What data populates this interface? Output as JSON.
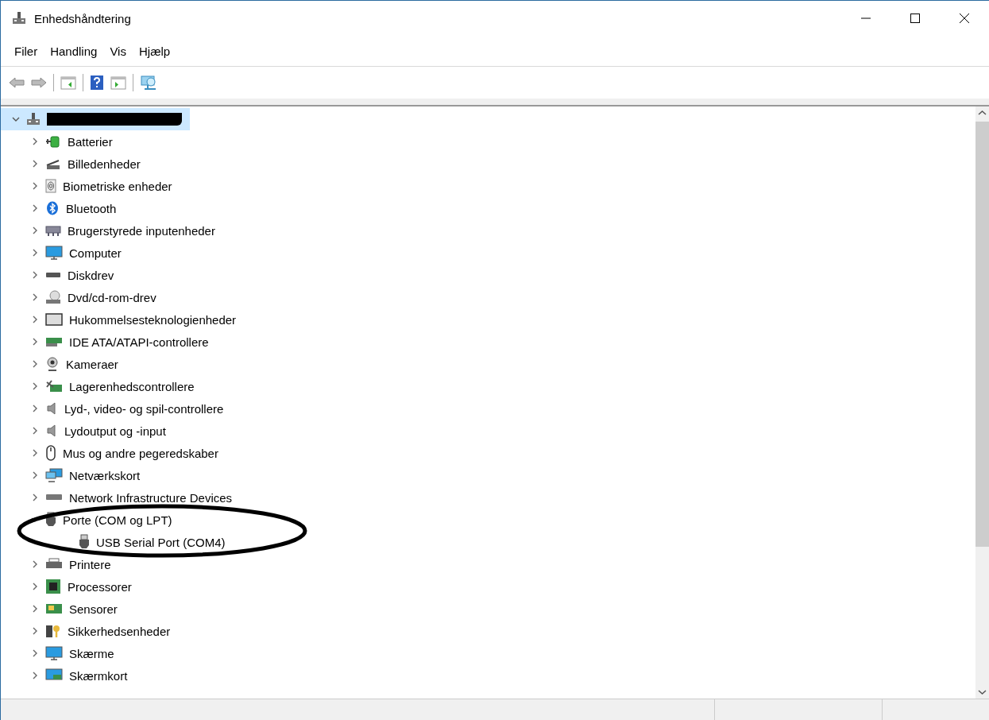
{
  "window": {
    "title": "Enhedshåndtering"
  },
  "menu": [
    "Filer",
    "Handling",
    "Vis",
    "Hjælp"
  ],
  "tree": {
    "expanded": true,
    "selected": true,
    "redacted": true,
    "children": [
      {
        "label": "Batterier",
        "expanded": false,
        "selected": false
      },
      {
        "label": "Billedenheder",
        "expanded": false,
        "selected": false
      },
      {
        "label": "Biometriske enheder",
        "expanded": false,
        "selected": false
      },
      {
        "label": "Bluetooth",
        "expanded": false,
        "selected": false
      },
      {
        "label": "Brugerstyrede inputenheder",
        "expanded": false,
        "selected": false
      },
      {
        "label": "Computer",
        "expanded": false,
        "selected": false
      },
      {
        "label": "Diskdrev",
        "expanded": false,
        "selected": false
      },
      {
        "label": "Dvd/cd-rom-drev",
        "expanded": false,
        "selected": false
      },
      {
        "label": "Hukommelsesteknologienheder",
        "expanded": false,
        "selected": false
      },
      {
        "label": "IDE ATA/ATAPI-controllere",
        "expanded": false,
        "selected": false
      },
      {
        "label": "Kameraer",
        "expanded": false,
        "selected": false
      },
      {
        "label": "Lagerenhedscontrollere",
        "expanded": false,
        "selected": false
      },
      {
        "label": "Lyd-, video- og spil-controllere",
        "expanded": false,
        "selected": false
      },
      {
        "label": "Lydoutput og -input",
        "expanded": false,
        "selected": false
      },
      {
        "label": "Mus og andre pegeredskaber",
        "expanded": false,
        "selected": false
      },
      {
        "label": "Netværkskort",
        "expanded": false,
        "selected": false
      },
      {
        "label": "Network Infrastructure Devices",
        "expanded": false,
        "selected": false
      },
      {
        "label": "Porte (COM og LPT)",
        "expanded": true,
        "selected": false,
        "children": [
          {
            "label": "USB Serial Port (COM4)",
            "selected": false
          }
        ]
      },
      {
        "label": "Printere",
        "expanded": false,
        "selected": false
      },
      {
        "label": "Processorer",
        "expanded": false,
        "selected": false
      },
      {
        "label": "Sensorer",
        "expanded": false,
        "selected": false
      },
      {
        "label": "Sikkerhedsenheder",
        "expanded": false,
        "selected": false
      },
      {
        "label": "Skærme",
        "expanded": false,
        "selected": false
      },
      {
        "label": "Skærmkort",
        "expanded": false,
        "selected": false
      }
    ]
  },
  "annotation": {
    "kind": "ellipse"
  }
}
